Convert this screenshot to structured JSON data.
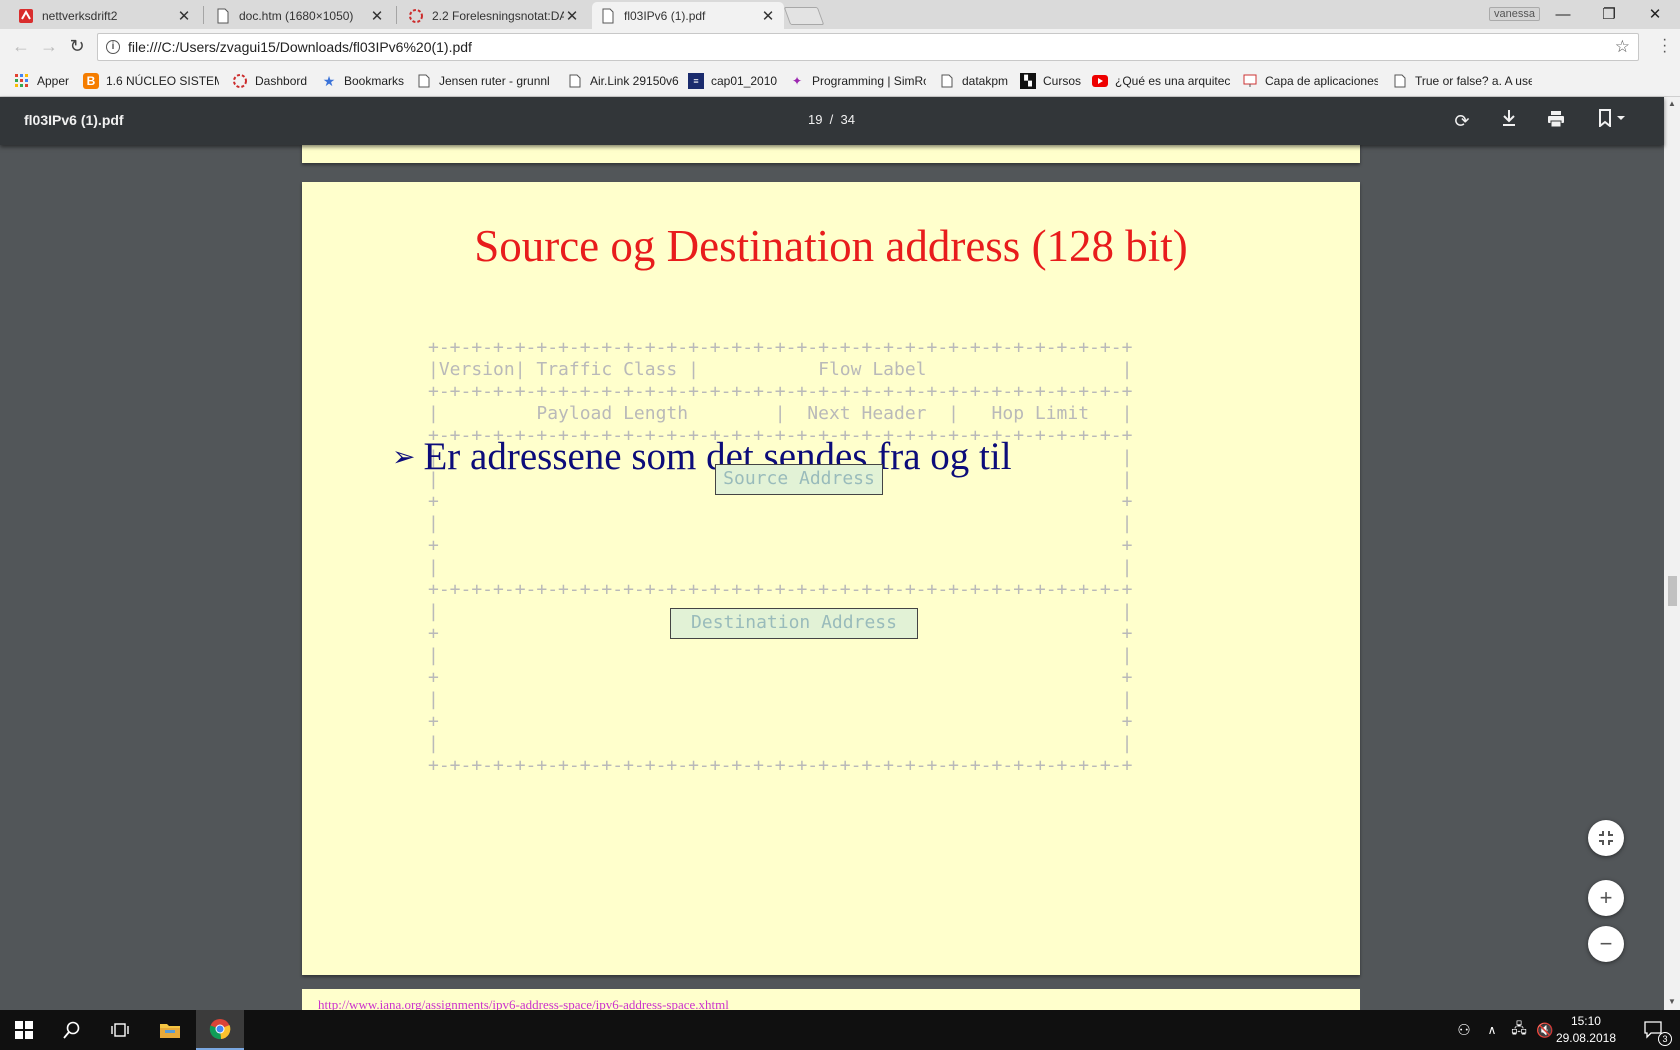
{
  "browser": {
    "tabs": [
      {
        "title": "nettverksdrift2",
        "icon": "red-app-icon",
        "active": false
      },
      {
        "title": "doc.htm (1680×1050)",
        "icon": "document-icon",
        "active": false
      },
      {
        "title": "2.2 Forelesningsnotat:DA",
        "icon": "loading-ring-icon",
        "active": false
      },
      {
        "title": "fl03IPv6 (1).pdf",
        "icon": "document-icon",
        "active": true
      }
    ],
    "profile_name": "vanessa",
    "url": "file:///C:/Users/zvagui15/Downloads/fl03IPv6%20(1).pdf",
    "bookmarks": [
      {
        "label": "Apper",
        "icon": "apps-grid-icon"
      },
      {
        "label": "1.6 NÚCLEO SISTEMA",
        "icon": "blogger-icon"
      },
      {
        "label": "Dashbord",
        "icon": "loading-ring-icon"
      },
      {
        "label": "Bookmarks",
        "icon": "star-icon"
      },
      {
        "label": "Jensen ruter - grunnl",
        "icon": "page-icon"
      },
      {
        "label": "Air.Link 29150v6",
        "icon": "page-icon"
      },
      {
        "label": "cap01_2010",
        "icon": "logo-icon"
      },
      {
        "label": "Programming | SimRo",
        "icon": "sparkle-icon"
      },
      {
        "label": "datakpm",
        "icon": "page-icon"
      },
      {
        "label": "Cursos",
        "icon": "film-icon"
      },
      {
        "label": "¿Qué es una arquitec",
        "icon": "youtube-icon"
      },
      {
        "label": "Capa de aplicaciones",
        "icon": "slides-icon"
      },
      {
        "label": "True or false? a. A use",
        "icon": "page-icon"
      }
    ]
  },
  "pdf_viewer": {
    "file_name": "fl03IPv6 (1).pdf",
    "page_indicator": "19  /  34"
  },
  "slide": {
    "title": "Source og Destination address (128 bit)",
    "bullet": "Er adressene som det sendes fra og til",
    "ascii_header": "+-+-+-+-+-+-+-+-+-+-+-+-+-+-+-+-+-+-+-+-+-+-+-+-+-+-+-+-+-+-+-+-+\n|Version| Traffic Class |           Flow Label                  |\n+-+-+-+-+-+-+-+-+-+-+-+-+-+-+-+-+-+-+-+-+-+-+-+-+-+-+-+-+-+-+-+-+\n|         Payload Length        |  Next Header  |   Hop Limit   |\n+-+-+-+-+-+-+-+-+-+-+-+-+-+-+-+-+-+-+-+-+-+-+-+-+-+-+-+-+-+-+-+-+\n|                                                               |\n|                                                               |\n+                                                               +\n|                                                               |\n+                                                               +\n|                                                               |\n+-+-+-+-+-+-+-+-+-+-+-+-+-+-+-+-+-+-+-+-+-+-+-+-+-+-+-+-+-+-+-+-+\n|                                                               |\n+                                                               +\n|                                                               |\n+                                                               +\n|                                                               |\n+                                                               +\n|                                                               |\n+-+-+-+-+-+-+-+-+-+-+-+-+-+-+-+-+-+-+-+-+-+-+-+-+-+-+-+-+-+-+-+-+",
    "source_label": "Source Address",
    "destination_label": "Destination Address"
  },
  "next_page_link": "http://www.iana.org/assignments/ipv6-address-space/ipv6-address-space.xhtml",
  "taskbar": {
    "time": "15:10",
    "date": "29.08.2018",
    "notification_count": "3"
  }
}
